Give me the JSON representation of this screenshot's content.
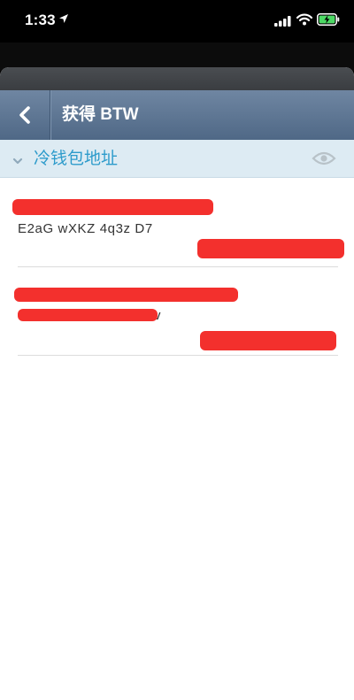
{
  "status_bar": {
    "time": "1:33"
  },
  "nav": {
    "title": "获得 BTW",
    "back_icon": "chevron-left-icon"
  },
  "section": {
    "title": "冷钱包地址",
    "eye_icon": "eye-icon",
    "color": "#2d9bcb"
  },
  "addresses": [
    {
      "text": "E2aG wXKZ 4q3z D7"
    },
    {
      "text": "v"
    }
  ],
  "colors": {
    "nav_bar": "#5b7392",
    "section_bg": "#ddebf3",
    "redaction": "#f3302d"
  }
}
